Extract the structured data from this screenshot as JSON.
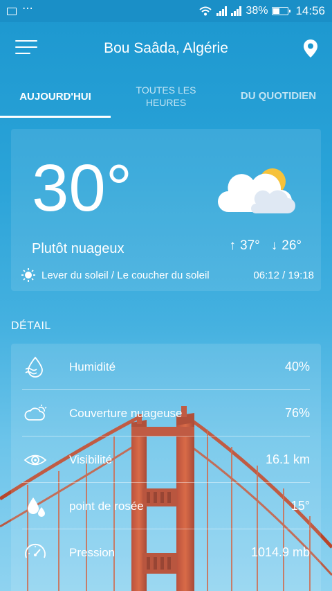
{
  "status_bar": {
    "battery": "38%",
    "time": "14:56",
    "signal_label_1": "4G",
    "signal_label_2": "4G"
  },
  "header": {
    "location": "Bou Saâda, Algérie"
  },
  "tabs": [
    {
      "label": "AUJOURD'HUI",
      "active": true
    },
    {
      "label": "TOUTES LES HEURES",
      "active": false
    },
    {
      "label": "DU QUOTIDIEN",
      "active": false
    }
  ],
  "current": {
    "temperature": "30°",
    "condition": "Plutôt nuageux",
    "high": "37°",
    "low": "26°",
    "sun_label": "Lever du soleil / Le coucher du soleil",
    "sun_times": "06:12 / 19:18",
    "icon": "partly-cloudy-icon"
  },
  "detail": {
    "title": "DÉTAIL",
    "rows": [
      {
        "label": "Humidité",
        "value": "40%",
        "icon": "humidity-icon"
      },
      {
        "label": "Couverture nuageuse",
        "value": "76%",
        "icon": "cloud-cover-icon"
      },
      {
        "label": "Visibilité",
        "value": "16.1 km",
        "icon": "visibility-icon"
      },
      {
        "label": "point de rosée",
        "value": "15°",
        "icon": "dew-point-icon"
      },
      {
        "label": "Pression",
        "value": "1014.9 mb",
        "icon": "pressure-icon"
      }
    ]
  },
  "colors": {
    "accent": "#1c97cf",
    "sun": "#f6c23a",
    "bridge": "#c24b2b"
  }
}
